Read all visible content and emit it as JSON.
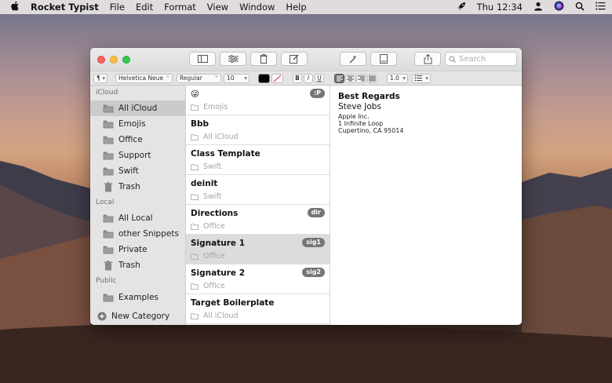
{
  "menubar": {
    "app": "Rocket Typist",
    "items": [
      "File",
      "Edit",
      "Format",
      "View",
      "Window",
      "Help"
    ],
    "clock": "Thu 12:34"
  },
  "toolbar": {
    "search_placeholder": "Search"
  },
  "format": {
    "paragraph": "¶",
    "font": "Helvetica Neue",
    "style": "Regular",
    "size": "10",
    "bold": "B",
    "italic": "I",
    "underline": "U",
    "spacing": "1.0"
  },
  "sidebar": {
    "sections": [
      {
        "title": "iCloud",
        "items": [
          {
            "label": "All iCloud",
            "icon": "icloud-folder"
          },
          {
            "label": "Emojis",
            "icon": "folder"
          },
          {
            "label": "Office",
            "icon": "folder"
          },
          {
            "label": "Support",
            "icon": "folder"
          },
          {
            "label": "Swift",
            "icon": "folder"
          },
          {
            "label": "Trash",
            "icon": "trash"
          }
        ]
      },
      {
        "title": "Local",
        "items": [
          {
            "label": "All Local",
            "icon": "local-folder"
          },
          {
            "label": "other Snippets",
            "icon": "folder"
          },
          {
            "label": "Private",
            "icon": "folder"
          },
          {
            "label": "Trash",
            "icon": "trash"
          }
        ]
      },
      {
        "title": "Public",
        "items": [
          {
            "label": "Examples",
            "icon": "folder"
          }
        ]
      }
    ],
    "new_category": "New Category",
    "selected": "All iCloud"
  },
  "snippets": [
    {
      "title": "😜",
      "folder": "Emojis",
      "badge": ":P"
    },
    {
      "title": "Bbb",
      "folder": "All iCloud",
      "badge": ""
    },
    {
      "title": "Class Template",
      "folder": "Swift",
      "badge": ""
    },
    {
      "title": "deinit",
      "folder": "Swift",
      "badge": ""
    },
    {
      "title": "Directions",
      "folder": "Office",
      "badge": "dir"
    },
    {
      "title": "Signature 1",
      "folder": "Office",
      "badge": "sig1",
      "selected": true
    },
    {
      "title": "Signature 2",
      "folder": "Office",
      "badge": "sig2"
    },
    {
      "title": "Target Boilerplate",
      "folder": "All iCloud",
      "badge": ""
    }
  ],
  "editor": {
    "heading": "Best Regards",
    "name": "Steve Jobs",
    "lines": [
      "Apple Inc.",
      "1 Infinite Loop",
      "Cupertino, CA 95014"
    ]
  },
  "colors": {
    "selection": "#cbcbcb",
    "badge": "#767676",
    "close": "#fc605c",
    "minimize": "#fdbc40",
    "zoom": "#34c84a"
  }
}
